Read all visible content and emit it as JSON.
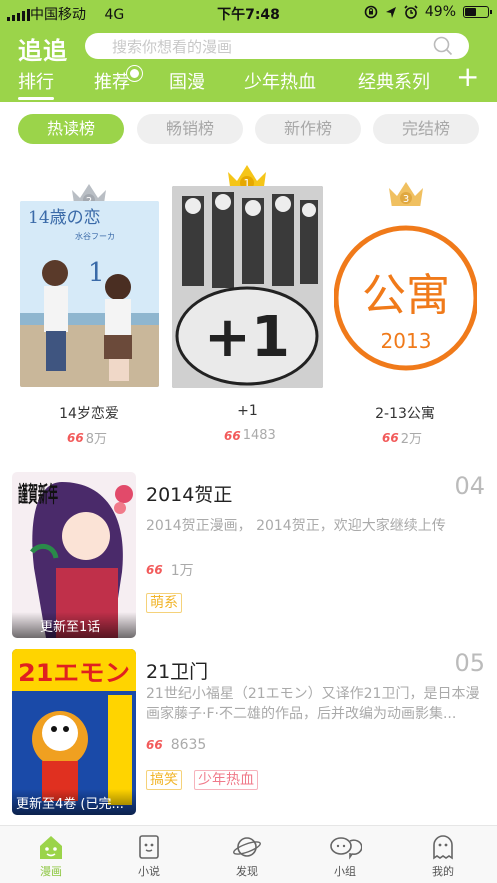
{
  "status_bar": {
    "carrier": "中国移动",
    "network": "4G",
    "time": "下午7:48",
    "battery": "49%",
    "battery_level": 0.49
  },
  "header": {
    "logo": "追追",
    "search_placeholder": "搜索你想看的漫画",
    "tabs": [
      "排行",
      "推荐",
      "国漫",
      "少年热血",
      "经典系列"
    ],
    "active_tab": 0
  },
  "rank_chips": [
    "热读榜",
    "畅销榜",
    "新作榜",
    "完结榜"
  ],
  "active_chip": 0,
  "podium": [
    {
      "rank": "2",
      "title": "14岁恋爱",
      "hot": "8万",
      "cover_text": "14歳の恋",
      "cover_author": "水谷フーカ",
      "cover_volume": "1"
    },
    {
      "rank": "1",
      "title": "+1",
      "hot": "1483",
      "cover_text": "+1"
    },
    {
      "rank": "3",
      "title": "2-13公寓",
      "hot": "2万",
      "cover_text": "公寓",
      "cover_subtext": "2013"
    }
  ],
  "list": [
    {
      "rank": "04",
      "name": "2014贺正",
      "desc": "2014贺正漫画，  2014贺正，欢迎大家继续上传",
      "hot": "1万",
      "update": "更新至1话",
      "cover_text": "謹賀新年",
      "tags": [
        "萌系"
      ]
    },
    {
      "rank": "05",
      "name": "21卫门",
      "desc": "21世纪小福星（21エモン）又译作21卫门，是日本漫画家藤子·F·不二雄的作品，后并改编为动画影集...",
      "hot": "8635",
      "update": "更新至4卷 (已完...",
      "cover_text": "21エモン",
      "tags": [
        "搞笑",
        "少年热血"
      ]
    }
  ],
  "bottom_nav": [
    "漫画",
    "小说",
    "发现",
    "小组",
    "我的"
  ],
  "active_nav": 0,
  "colors": {
    "brand": "#9bd44a",
    "crown_gold": "#f5c518",
    "crown_silver": "#b9bec4",
    "crown_bronze": "#f0c060",
    "tag_yellow": "#f1b52a",
    "tag_pink": "#f07a8a",
    "hot_red": "#f25a5a"
  },
  "icons": {
    "flame": "66",
    "crown": "crown-icon",
    "search": "search-icon",
    "plus": "+"
  }
}
